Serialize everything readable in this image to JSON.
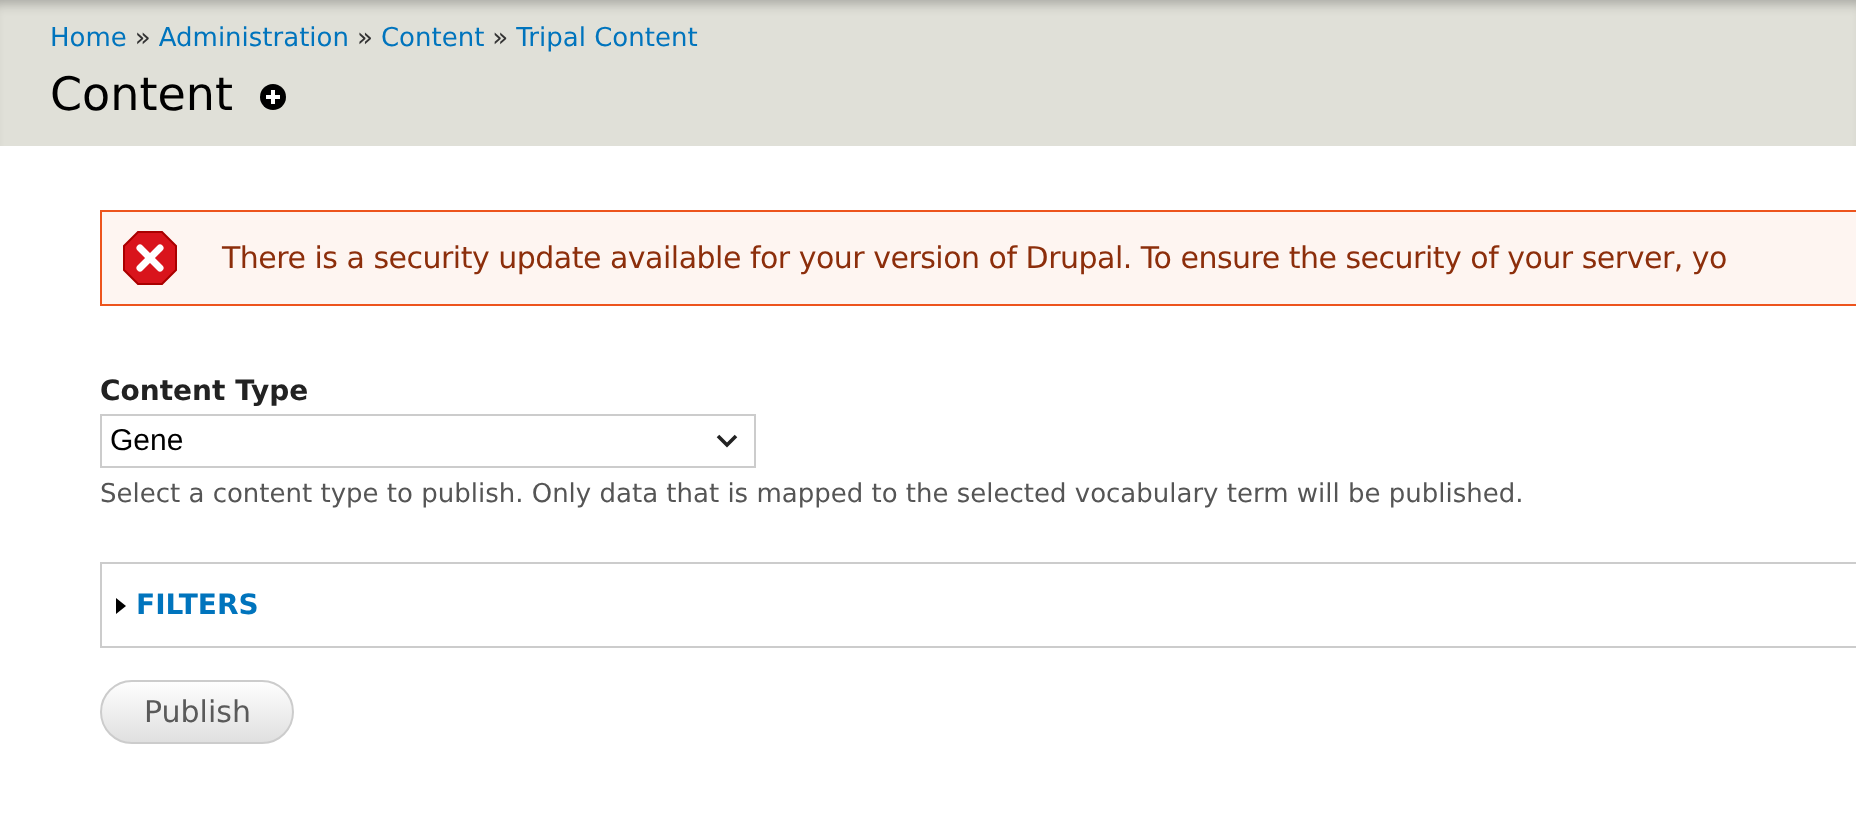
{
  "breadcrumb": [
    {
      "kind": "link",
      "text": "Home"
    },
    {
      "kind": "separator",
      "text": "»"
    },
    {
      "kind": "link",
      "text": "Administration"
    },
    {
      "kind": "separator",
      "text": "»"
    },
    {
      "kind": "link",
      "text": "Content"
    },
    {
      "kind": "separator",
      "text": "»"
    },
    {
      "kind": "link",
      "text": "Tripal Content"
    }
  ],
  "page_title": "Content",
  "message": {
    "kind": "error",
    "text": "There is a security update available for your version of Drupal. To ensure the security of your server, yo"
  },
  "content_type": {
    "label": "Content Type",
    "value": "Gene",
    "description": "Select a content type to publish. Only data that is mapped to the selected vocabulary term will be published."
  },
  "filters": {
    "label": "FILTERS",
    "expanded": false
  },
  "buttons": [
    "Publish"
  ]
}
